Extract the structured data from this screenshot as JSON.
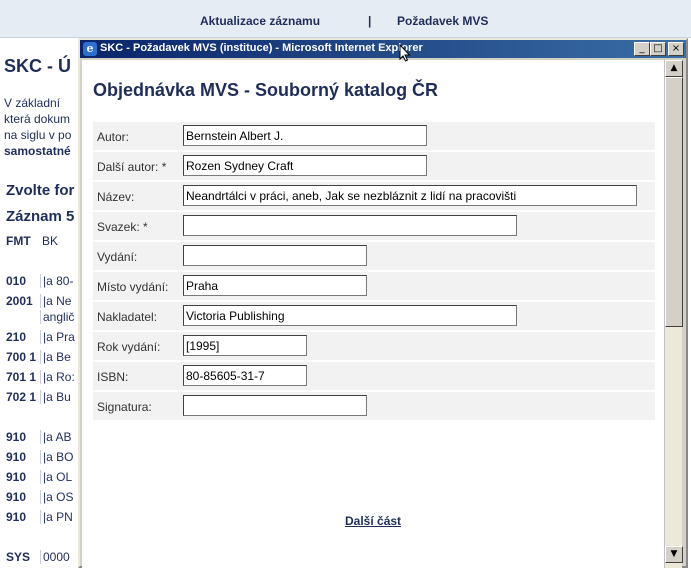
{
  "background": {
    "nav": {
      "update_record": "Aktualizace záznamu",
      "separator": "|",
      "mvs_request": "Požadavek MVS"
    },
    "page_title": "SKC - Ú",
    "paragraph": [
      "V základní",
      "která dokum",
      "na siglu v po",
      "samostatné"
    ],
    "heading_format": "Zvolte for",
    "heading_record": "Záznam 5",
    "col_fmt": "FMT",
    "col_bk": "BK",
    "rows": [
      {
        "tag": "010",
        "val": "|a 80-"
      },
      {
        "tag": "2001",
        "val": "|a Ne"
      },
      {
        "tag": "",
        "val": "anglič"
      },
      {
        "tag": "210",
        "val": "|a Pra"
      },
      {
        "tag": "700 1",
        "val": "|a Be"
      },
      {
        "tag": "701 1",
        "val": "|a Ro:"
      },
      {
        "tag": "702 1",
        "val": "|a Bu"
      },
      {
        "tag": "910",
        "val": "|a AB"
      },
      {
        "tag": "910",
        "val": "|a BO"
      },
      {
        "tag": "910",
        "val": "|a OL"
      },
      {
        "tag": "910",
        "val": "|a OS"
      },
      {
        "tag": "910",
        "val": "|a PN"
      },
      {
        "tag": "SYS",
        "val": "0000"
      }
    ]
  },
  "window": {
    "title": "SKC - Požadavek MVS (instituce) - Microsoft Internet Explorer",
    "icon": "ie-icon",
    "buttons": {
      "minimize": "_",
      "maximize": "□",
      "close": "×"
    }
  },
  "form": {
    "heading": "Objednávka MVS - Souborný katalog ČR",
    "fields": [
      {
        "label": "Autor:",
        "value": "Bernstein Albert J."
      },
      {
        "label": "Další autor: *",
        "value": "Rozen Sydney Craft"
      },
      {
        "label": "Název:",
        "value": "Neandrtálci v práci, aneb, Jak se nezbláznit z lidí na pracovišti"
      },
      {
        "label": "Svazek: *",
        "value": ""
      },
      {
        "label": "Vydání:",
        "value": ""
      },
      {
        "label": "Místo vydání:",
        "value": "Praha"
      },
      {
        "label": "Nakladatel:",
        "value": "Victoria Publishing"
      },
      {
        "label": "Rok vydání:",
        "value": "[1995]"
      },
      {
        "label": "ISBN:",
        "value": "80-85605-31-7"
      },
      {
        "label": "Signatura:",
        "value": ""
      }
    ],
    "next_link": "Další část"
  },
  "scrollbar": {
    "up": "▲",
    "down": "▼"
  }
}
